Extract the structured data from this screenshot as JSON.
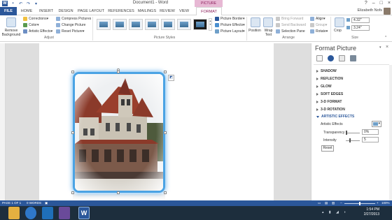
{
  "window": {
    "title": "Document1 - Word",
    "context_tab_group": "PICTURE TOOLS",
    "controls": [
      "?",
      "–",
      "□",
      "×"
    ]
  },
  "tabs": [
    {
      "label": "FILE"
    },
    {
      "label": "HOME"
    },
    {
      "label": "INSERT"
    },
    {
      "label": "DESIGN"
    },
    {
      "label": "PAGE LAYOUT"
    },
    {
      "label": "REFERENCES"
    },
    {
      "label": "MAILINGS"
    },
    {
      "label": "REVIEW"
    },
    {
      "label": "VIEW"
    },
    {
      "label": "FORMAT"
    }
  ],
  "user": {
    "name": "Elizabeth Nofs"
  },
  "ribbon": {
    "adjust": {
      "remove_bg": "Remove Background",
      "corrections": "Corrections",
      "color": "Color",
      "artistic": "Artistic Effects",
      "compress": "Compress Pictures",
      "change": "Change Picture",
      "reset": "Reset Picture",
      "group": "Adjust"
    },
    "styles": {
      "group": "Picture Styles",
      "border": "Picture Border",
      "effects": "Picture Effects",
      "layout": "Picture Layout"
    },
    "arrange": {
      "position": "Position",
      "wrap": "Wrap Text",
      "forward": "Bring Forward",
      "backward": "Send Backward",
      "selection": "Selection Pane",
      "align": "Align",
      "group_cmd": "Group",
      "rotate": "Rotate",
      "group": "Arrange"
    },
    "size": {
      "crop": "Crop",
      "height": "4.32\"",
      "width": "3.24\"",
      "group": "Size"
    }
  },
  "pane": {
    "title": "Format Picture",
    "sections": [
      "SHADOW",
      "REFLECTION",
      "GLOW",
      "SOFT EDGES",
      "3-D FORMAT",
      "3-D ROTATION",
      "ARTISTIC EFFECTS"
    ],
    "artistic_label": "Artistic Effects",
    "transparency_label": "Transparency",
    "transparency_value": "0%",
    "intensity_label": "Intensity",
    "intensity_value": "5",
    "reset_label": "Reset"
  },
  "status": {
    "page": "PAGE 1 OF 1",
    "words": "0 WORDS",
    "zoom": "100%"
  },
  "clock": {
    "time": "1:54 PM",
    "date": "2/27/2013"
  },
  "colors": {
    "accent": "#2b579a",
    "context": "#8b1e5a",
    "selection": "#4ba3e4"
  }
}
